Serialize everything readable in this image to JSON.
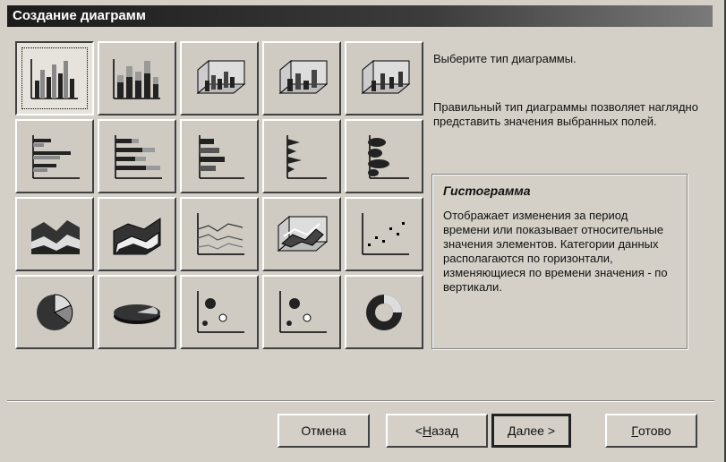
{
  "window": {
    "title": "Создание диаграмм"
  },
  "chart_types": [
    {
      "icon": "column-chart-icon"
    },
    {
      "icon": "stacked-column-chart-icon"
    },
    {
      "icon": "3d-column-chart-icon"
    },
    {
      "icon": "3d-stacked-column-chart-icon"
    },
    {
      "icon": "3d-percent-column-chart-icon"
    },
    {
      "icon": "bar-chart-icon"
    },
    {
      "icon": "stacked-bar-chart-icon"
    },
    {
      "icon": "percent-bar-chart-icon"
    },
    {
      "icon": "3d-bar-chart-icon"
    },
    {
      "icon": "3d-stacked-bar-chart-icon"
    },
    {
      "icon": "area-chart-icon"
    },
    {
      "icon": "3d-area-chart-icon"
    },
    {
      "icon": "line-chart-icon"
    },
    {
      "icon": "3d-line-chart-icon"
    },
    {
      "icon": "scatter-chart-icon"
    },
    {
      "icon": "pie-chart-icon"
    },
    {
      "icon": "3d-pie-chart-icon"
    },
    {
      "icon": "bubble-chart-icon"
    },
    {
      "icon": "bubble-chart-alt-icon"
    },
    {
      "icon": "doughnut-chart-icon"
    }
  ],
  "prompt": "Выберите тип диаграммы.",
  "hint": "Правильный тип диаграммы позволяет наглядно представить значения выбранных полей.",
  "description": {
    "title": "Гистограмма",
    "text": "Отображает изменения за период времени или показывает относительные значения элементов. Категории данных располагаются по горизонтали, изменяющиеся по времени значения - по вертикали."
  },
  "buttons": {
    "cancel": "Отмена",
    "back_prefix": "< ",
    "back_hotkey": "Н",
    "back_rest": "азад",
    "next_hotkey": "Д",
    "next_rest": "алее >",
    "finish_hotkey": "Г",
    "finish_rest": "отово"
  }
}
